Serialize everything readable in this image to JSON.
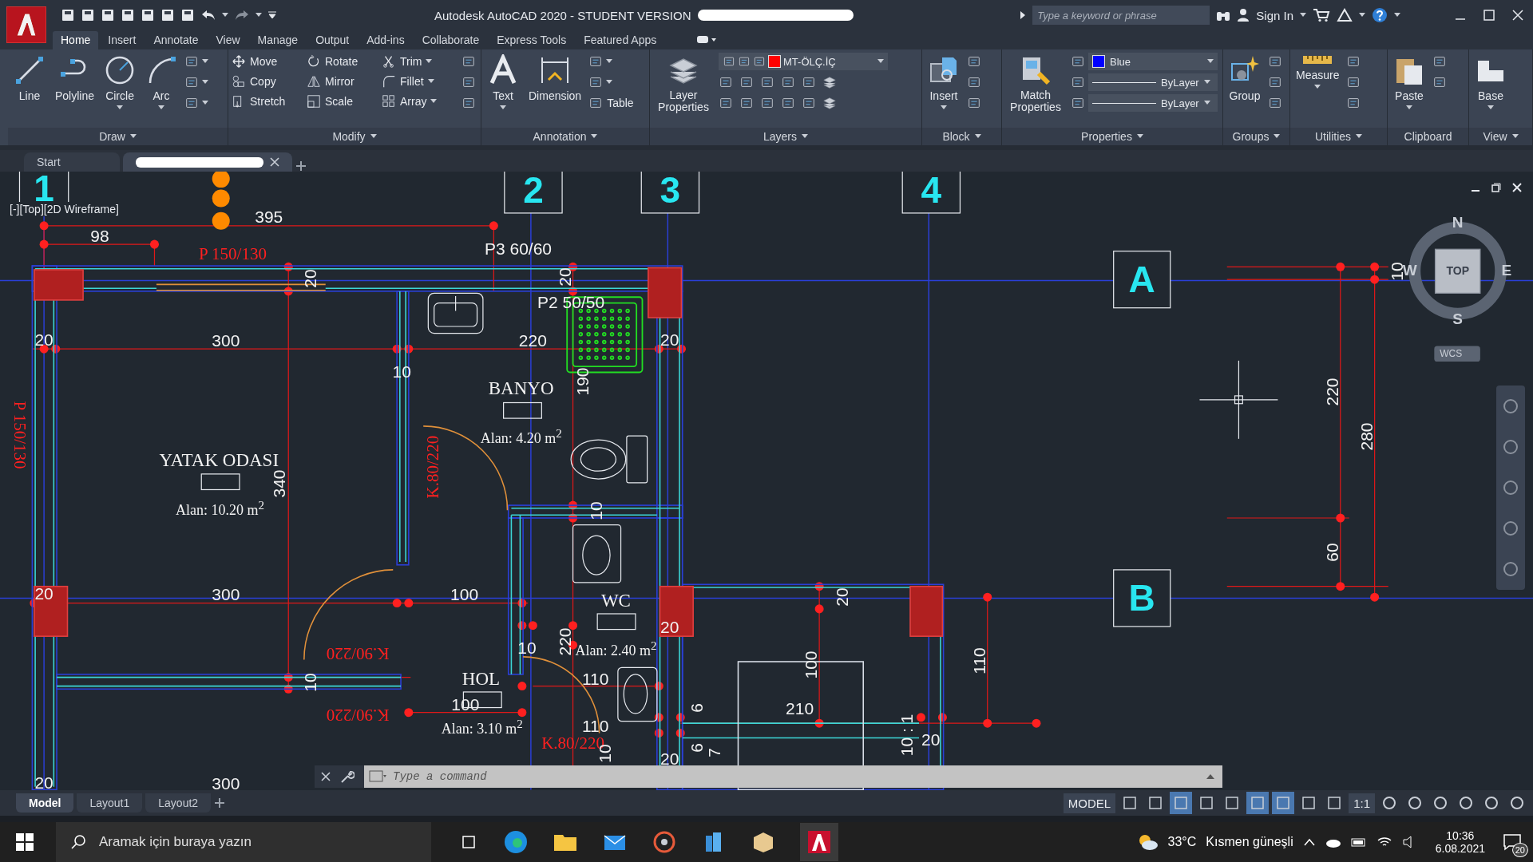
{
  "title_bar": {
    "title": "Autodesk AutoCAD 2020 - STUDENT VERSION",
    "search": {
      "placeholder": "Type a keyword or phrase"
    },
    "sign_in": "Sign In"
  },
  "ribbon": {
    "tabs": [
      {
        "label": "Home",
        "selected": true
      },
      {
        "label": "Insert",
        "selected": false
      },
      {
        "label": "Annotate",
        "selected": false
      },
      {
        "label": "View",
        "selected": false
      },
      {
        "label": "Manage",
        "selected": false
      },
      {
        "label": "Output",
        "selected": false
      },
      {
        "label": "Add-ins",
        "selected": false
      },
      {
        "label": "Collaborate",
        "selected": false
      },
      {
        "label": "Express Tools",
        "selected": false
      },
      {
        "label": "Featured Apps",
        "selected": false
      }
    ],
    "draw": {
      "title": "Draw",
      "tools": [
        "Line",
        "Polyline",
        "Circle",
        "Arc"
      ]
    },
    "modify": {
      "title": "Modify",
      "tools": [
        "Move",
        "Rotate",
        "Trim",
        "Copy",
        "Mirror",
        "Fillet",
        "Stretch",
        "Scale",
        "Array"
      ]
    },
    "annotation": {
      "title": "Annotation",
      "tools": [
        "Text",
        "Dimension"
      ],
      "table": "Table"
    },
    "layers": {
      "title": "Layers",
      "tool": "Layer Properties",
      "current_layer": "MT-ÖLÇ.İÇ",
      "color": "#ff0000"
    },
    "block": {
      "title": "Block",
      "tool": "Insert"
    },
    "properties": {
      "title": "Properties",
      "tool": "Match Properties",
      "color_label": "Blue",
      "color": "#0000ff",
      "linetype": "ByLayer",
      "lineweight": "ByLayer"
    },
    "groups": {
      "title": "Groups",
      "tool": "Group"
    },
    "utilities": {
      "title": "Utilities",
      "tool": "Measure"
    },
    "clipboard": {
      "title": "Clipboard",
      "tool": "Paste"
    },
    "view": {
      "title": "View",
      "tool": "Base"
    }
  },
  "document_tabs": [
    {
      "label": "Start",
      "selected": false
    },
    {
      "redacted": true,
      "selected": true
    }
  ],
  "viewport": {
    "label": "[-][Top][2D Wireframe]"
  },
  "drawing": {
    "grid_bubbles": [
      "1",
      "2",
      "3",
      "4",
      "A",
      "B"
    ],
    "labels": [
      {
        "text": "395",
        "kind": "dim"
      },
      {
        "text": "98",
        "kind": "dim"
      },
      {
        "text": "P 150/130",
        "kind": "red"
      },
      {
        "text": "P3 60/60",
        "kind": "dim"
      },
      {
        "text": "20",
        "kind": "dim"
      },
      {
        "text": "20",
        "kind": "dim"
      },
      {
        "text": "P2 50/50",
        "kind": "dim"
      },
      {
        "text": "20",
        "kind": "dim"
      },
      {
        "text": "300",
        "kind": "dim"
      },
      {
        "text": "220",
        "kind": "dim"
      },
      {
        "text": "20",
        "kind": "dim"
      },
      {
        "text": "10",
        "kind": "dim"
      },
      {
        "text": "190",
        "kind": "dim"
      },
      {
        "text": "BANYO",
        "kind": "room"
      },
      {
        "text": "Alan:  4.20 m$^{2}$",
        "kind": "area"
      },
      {
        "text": "P 150/130",
        "kind": "red"
      },
      {
        "text": "K.80/220",
        "kind": "red"
      },
      {
        "text": "YATAK ODASI",
        "kind": "room"
      },
      {
        "text": "340",
        "kind": "dim"
      },
      {
        "text": "Alan: 10.20 m$^{2}$",
        "kind": "area"
      },
      {
        "text": "10",
        "kind": "dim"
      },
      {
        "text": "20",
        "kind": "dim"
      },
      {
        "text": "300",
        "kind": "dim"
      },
      {
        "text": "100",
        "kind": "dim"
      },
      {
        "text": "WC",
        "kind": "room"
      },
      {
        "text": "20",
        "kind": "dim"
      },
      {
        "text": "20",
        "kind": "dim"
      },
      {
        "text": "10",
        "kind": "dim"
      },
      {
        "text": "220",
        "kind": "dim"
      },
      {
        "text": "Alan:  2.40 m$^{2}$",
        "kind": "area"
      },
      {
        "text": "K.90/220",
        "kind": "red"
      },
      {
        "text": "100",
        "kind": "dim"
      },
      {
        "text": "110",
        "kind": "dim"
      },
      {
        "text": "HOL",
        "kind": "room"
      },
      {
        "text": "110",
        "kind": "dim"
      },
      {
        "text": "10",
        "kind": "dim"
      },
      {
        "text": "100",
        "kind": "dim"
      },
      {
        "text": "210",
        "kind": "dim"
      },
      {
        "text": "6",
        "kind": "dim"
      },
      {
        "text": "K.90/220",
        "kind": "red"
      },
      {
        "text": "Alan:  3.10 m$^{2}$",
        "kind": "area"
      },
      {
        "text": "110",
        "kind": "dim"
      },
      {
        "text": "K.80/220",
        "kind": "red"
      },
      {
        "text": "20",
        "kind": "dim"
      },
      {
        "text": "10 : 1",
        "kind": "dim"
      },
      {
        "text": "6",
        "kind": "dim"
      },
      {
        "text": "20",
        "kind": "dim"
      },
      {
        "text": "20",
        "kind": "dim"
      },
      {
        "text": "300",
        "kind": "dim"
      },
      {
        "text": "10",
        "kind": "dim"
      },
      {
        "text": "7",
        "kind": "dim"
      },
      {
        "text": "10",
        "kind": "dim"
      },
      {
        "text": "220",
        "kind": "dim"
      },
      {
        "text": "280",
        "kind": "dim"
      },
      {
        "text": "60",
        "kind": "dim"
      }
    ]
  },
  "viewcube": {
    "north": "N",
    "south": "S",
    "east": "E",
    "west": "W",
    "face": "TOP",
    "ucs": "WCS"
  },
  "command_line": {
    "placeholder": "Type a command"
  },
  "layout_tabs": [
    {
      "label": "Model",
      "selected": true
    },
    {
      "label": "Layout1",
      "selected": false
    },
    {
      "label": "Layout2",
      "selected": false
    }
  ],
  "status_bar": {
    "space": "MODEL",
    "scale": "1:1"
  },
  "taskbar": {
    "search_placeholder": "Aramak için buraya yazın",
    "temperature": "33°C",
    "weather": "Kısmen güneşli",
    "time": "10:36",
    "date": "6.08.2021",
    "notifications": "20"
  }
}
